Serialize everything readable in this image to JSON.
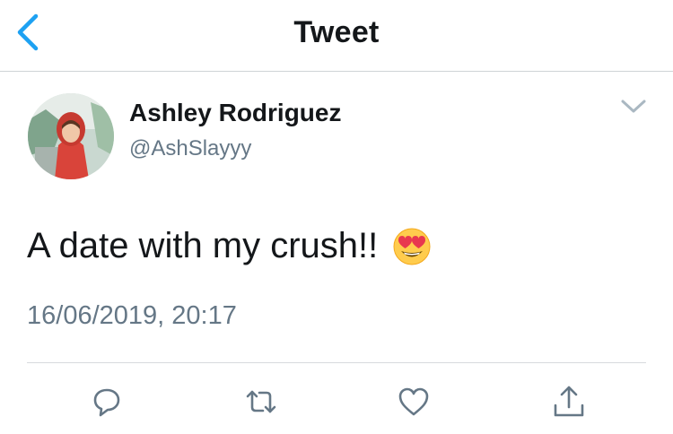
{
  "nav": {
    "title": "Tweet",
    "back_icon": "back-chevron-icon"
  },
  "author": {
    "name": "Ashley Rodriguez",
    "handle": "@AshSlayyy"
  },
  "tweet": {
    "text": "A date with my crush!!",
    "emoji": "😍",
    "timestamp": "16/06/2019, 20:17"
  },
  "actions": [
    {
      "name": "reply",
      "icon": "reply-icon"
    },
    {
      "name": "retweet",
      "icon": "retweet-icon"
    },
    {
      "name": "like",
      "icon": "heart-icon"
    },
    {
      "name": "share",
      "icon": "share-icon"
    }
  ],
  "colors": {
    "accent": "#1da1f2",
    "text": "#14171a",
    "secondary": "#657786",
    "icon": "#657786"
  }
}
